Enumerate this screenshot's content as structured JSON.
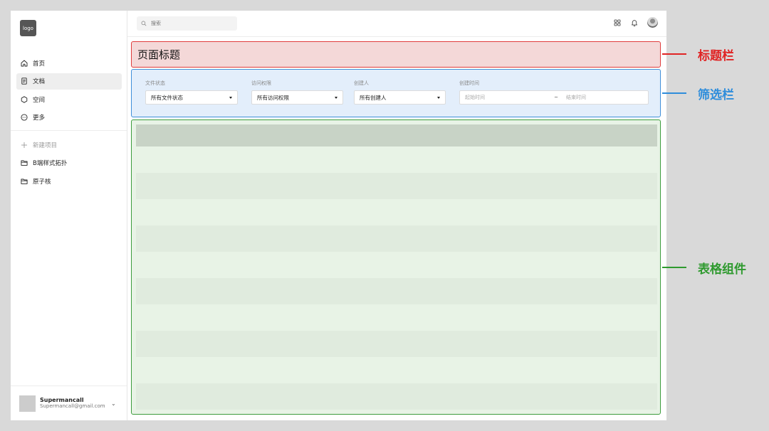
{
  "sidebar": {
    "logo": "logo",
    "nav": [
      {
        "label": "首页",
        "icon": "home-icon"
      },
      {
        "label": "文档",
        "icon": "document-icon",
        "active": true
      },
      {
        "label": "空间",
        "icon": "space-icon"
      },
      {
        "label": "更多",
        "icon": "more-icon"
      }
    ],
    "new_project": "新建项目",
    "projects": [
      {
        "label": "B端样式拓扑",
        "icon": "folder-icon"
      },
      {
        "label": "原子核",
        "icon": "folder-icon"
      }
    ],
    "user": {
      "name": "Supermancall",
      "email": "Supermancall@gmail.com"
    }
  },
  "topbar": {
    "search_placeholder": "搜索",
    "icons": [
      "apps-icon",
      "bell-icon",
      "user-avatar"
    ]
  },
  "page": {
    "title": "页面标题"
  },
  "filters": {
    "status": {
      "label": "文件状态",
      "value": "所有文件状态"
    },
    "access": {
      "label": "访问权限",
      "value": "所有访问权限"
    },
    "creator": {
      "label": "创建人",
      "value": "所有创建人"
    },
    "time": {
      "label": "创建时间",
      "start_placeholder": "起始时间",
      "separator": "~",
      "end_placeholder": "结束时间"
    }
  },
  "annotations": {
    "title_bar": {
      "text": "标题栏",
      "color": "#e02424"
    },
    "filter_bar": {
      "text": "筛选栏",
      "color": "#2f8ddb"
    },
    "table": {
      "text": "表格组件",
      "color": "#2f9a2f"
    }
  },
  "colors": {
    "title_box_border": "#e03c3c",
    "filter_box_border": "#3f8fd9",
    "table_box_border": "#3c9c3c"
  }
}
